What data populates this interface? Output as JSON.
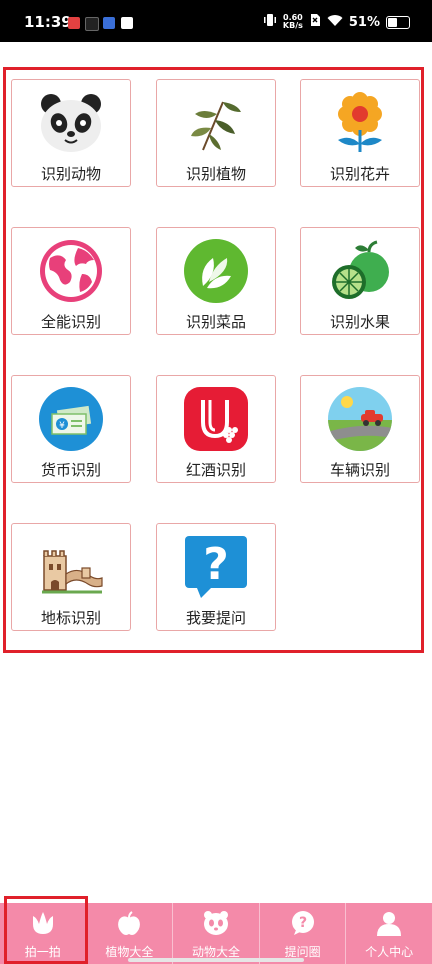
{
  "status_bar": {
    "time": "11:39",
    "net_speed_value": "0.60",
    "net_speed_unit": "KB/s",
    "battery": "51%",
    "battery_level": 0.51
  },
  "tiles": [
    {
      "label": "识别动物",
      "icon": "panda-icon"
    },
    {
      "label": "识别植物",
      "icon": "plant-icon"
    },
    {
      "label": "识别花卉",
      "icon": "flower-icon"
    },
    {
      "label": "全能识别",
      "icon": "globe-icon"
    },
    {
      "label": "识别菜品",
      "icon": "leaf-dish-icon"
    },
    {
      "label": "识别水果",
      "icon": "fruit-icon"
    },
    {
      "label": "货币识别",
      "icon": "money-icon"
    },
    {
      "label": "红酒识别",
      "icon": "wine-icon"
    },
    {
      "label": "车辆识别",
      "icon": "car-icon"
    },
    {
      "label": "地标识别",
      "icon": "great-wall-icon"
    },
    {
      "label": "我要提问",
      "icon": "question-icon"
    }
  ],
  "bottom_nav": [
    {
      "label": "拍一拍",
      "icon": "tulip-icon",
      "selected": true
    },
    {
      "label": "植物大全",
      "icon": "apple-icon"
    },
    {
      "label": "动物大全",
      "icon": "panda-face-icon"
    },
    {
      "label": "提问圈",
      "icon": "question-bubble-icon"
    },
    {
      "label": "个人中心",
      "icon": "user-icon"
    }
  ],
  "colors": {
    "accent": "#f48aa9",
    "highlight_border": "#e0202a",
    "tile_border": "#e9a7a7"
  }
}
